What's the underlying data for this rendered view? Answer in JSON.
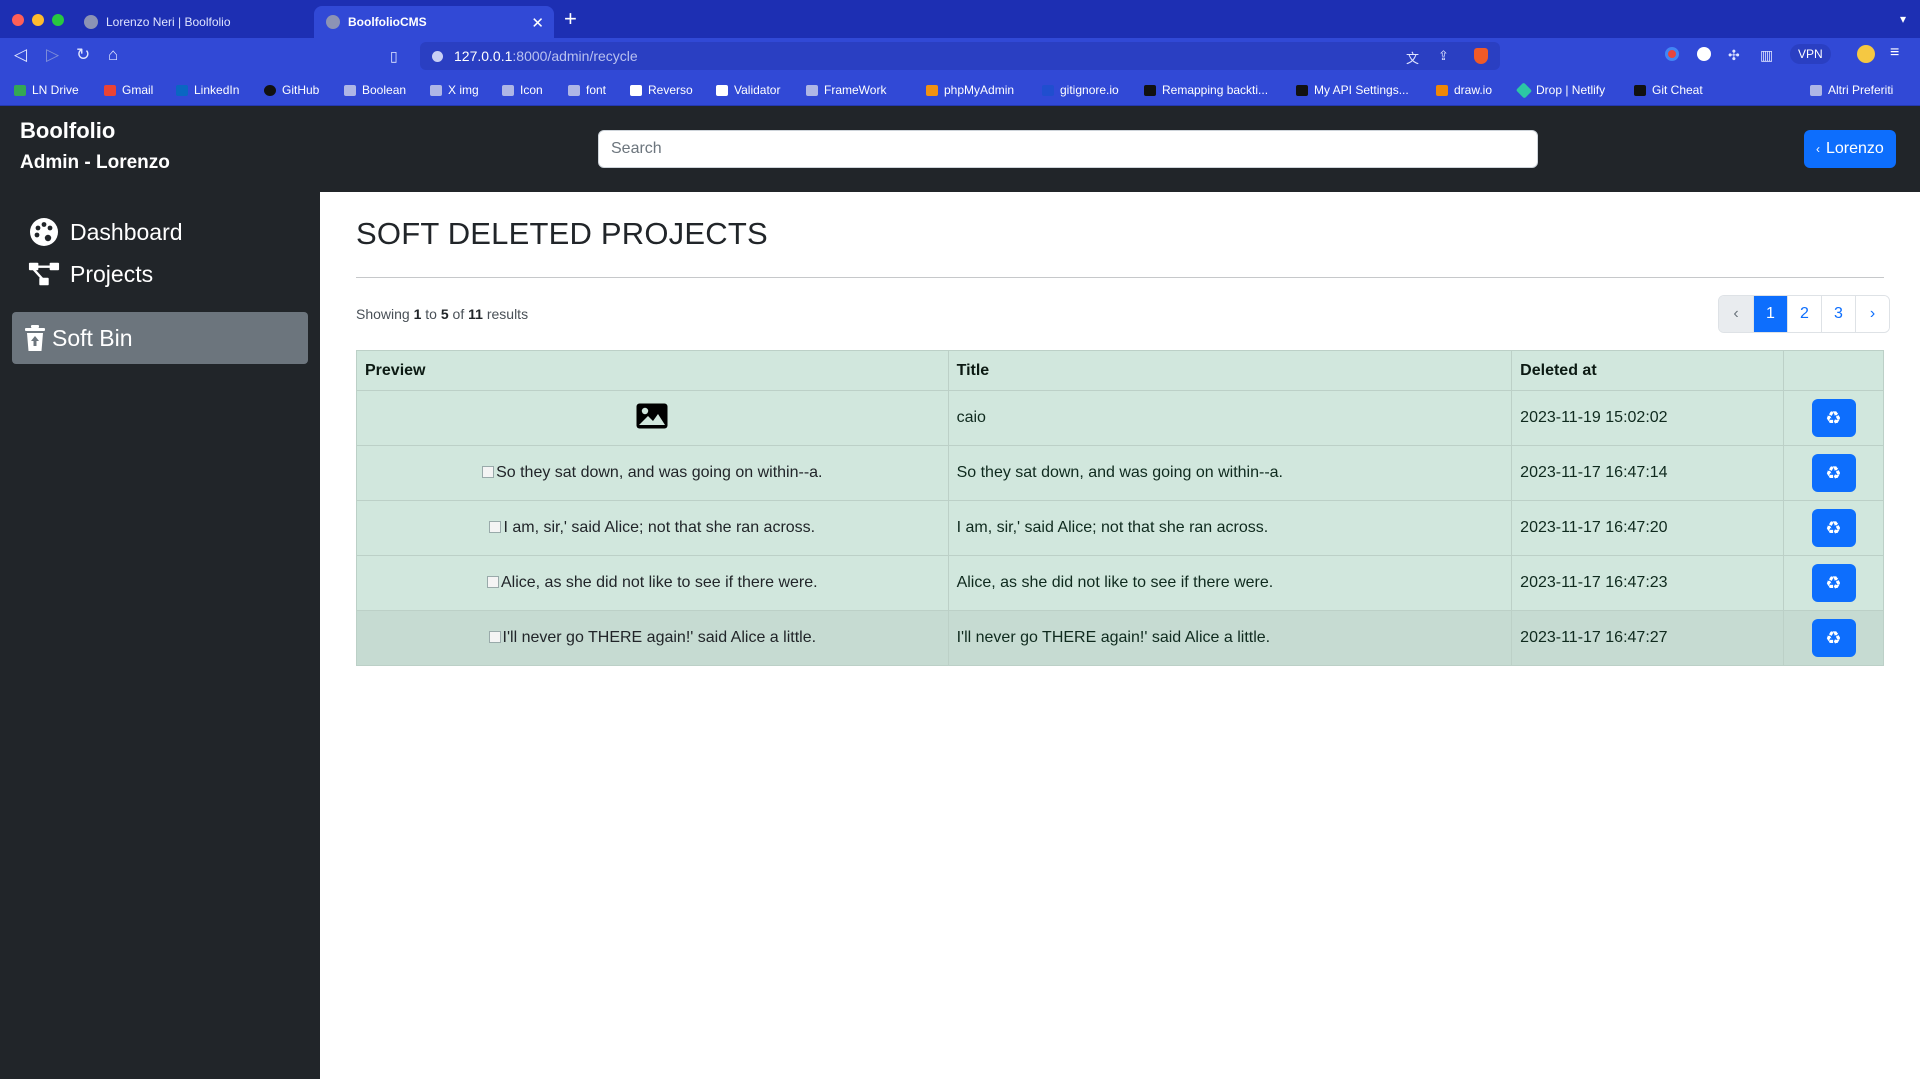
{
  "browser": {
    "tabs": [
      {
        "title": "Lorenzo Neri | Boolfolio",
        "active": false
      },
      {
        "title": "BoolfolioCMS",
        "active": true
      }
    ],
    "url_host": "127.0.0.1",
    "url_rest": ":8000/admin/recycle",
    "vpn_label": "VPN",
    "bookmarks": [
      "LN Drive",
      "Gmail",
      "LinkedIn",
      "GitHub",
      "Boolean",
      "X img",
      "Icon",
      "font",
      "Reverso",
      "Validator",
      "FrameWork",
      "phpMyAdmin",
      "gitignore.io",
      "Remapping backti...",
      "My API Settings...",
      "draw.io",
      "Drop | Netlify",
      "Git Cheat",
      "Altri Preferiti"
    ]
  },
  "header": {
    "brand": "Boolfolio",
    "subtitle": "Admin - Lorenzo",
    "search_placeholder": "Search",
    "user_button": "Lorenzo"
  },
  "sidebar": {
    "items": [
      {
        "label": "Dashboard",
        "icon": "palette-icon",
        "active": false
      },
      {
        "label": "Projects",
        "icon": "diagram-icon",
        "active": false
      },
      {
        "label": "Soft Bin",
        "icon": "trash-icon",
        "active": true
      }
    ]
  },
  "main": {
    "title": "SOFT DELETED PROJECTS",
    "results": {
      "prefix": "Showing",
      "from": "1",
      "to_word": "to",
      "to": "5",
      "of_word": "of",
      "total": "11",
      "suffix": "results"
    },
    "pagination": {
      "prev": "‹",
      "pages": [
        "1",
        "2",
        "3"
      ],
      "current": "1",
      "next": "›"
    },
    "table": {
      "columns": [
        "Preview",
        "Title",
        "Deleted at",
        ""
      ],
      "rows": [
        {
          "preview": "",
          "preview_icon": "image-icon",
          "title": "caio",
          "deleted_at": "2023-11-19 15:02:02"
        },
        {
          "preview": "So they sat down, and was going on within--a.",
          "title": "So they sat down, and was going on within--a.",
          "deleted_at": "2023-11-17 16:47:14"
        },
        {
          "preview": "I am, sir,' said Alice; not that she ran across.",
          "title": "I am, sir,' said Alice; not that she ran across.",
          "deleted_at": "2023-11-17 16:47:20"
        },
        {
          "preview": "Alice, as she did not like to see if there were.",
          "title": "Alice, as she did not like to see if there were.",
          "deleted_at": "2023-11-17 16:47:23"
        },
        {
          "preview": "I'll never go THERE again!' said Alice a little.",
          "title": "I'll never go THERE again!' said Alice a little.",
          "deleted_at": "2023-11-17 16:47:27"
        }
      ]
    }
  },
  "colors": {
    "browser_tabbar": "#1d2fb3",
    "browser_toolbar": "#3149d6",
    "app_dark": "#212529",
    "sidebar_active": "#6c757d",
    "primary": "#0d6efd",
    "table_row": "#d1e7dd"
  }
}
